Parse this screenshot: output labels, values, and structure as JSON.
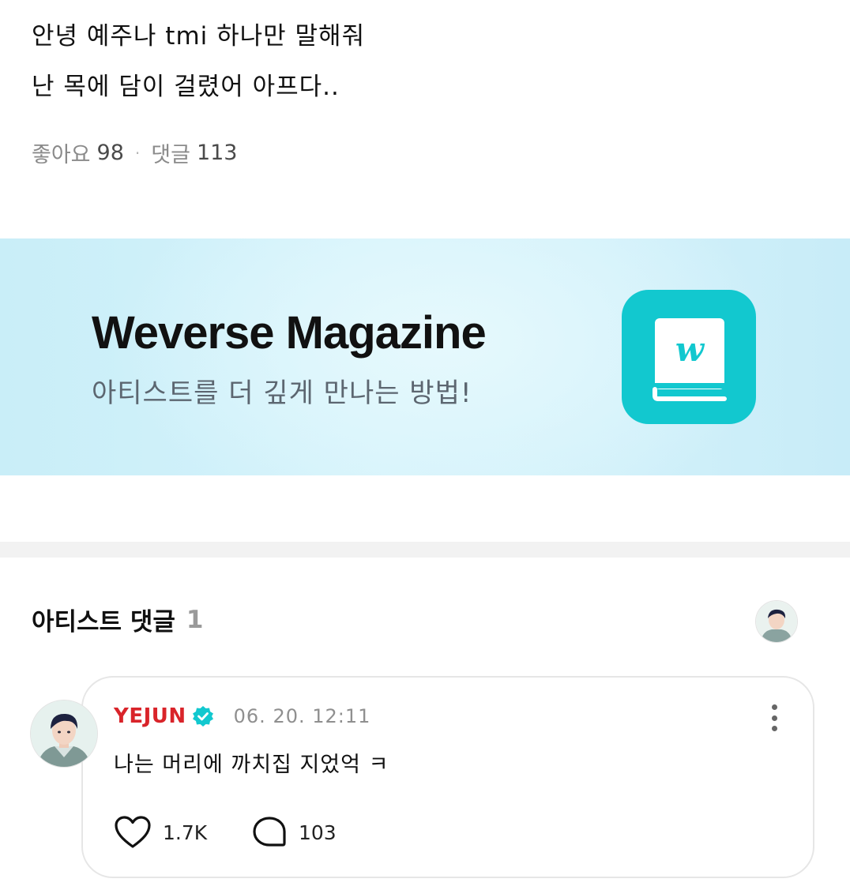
{
  "post": {
    "lines": [
      "안녕 예주나 tmi 하나만 말해줘",
      "난 목에 담이 걸렸어 아프다.."
    ],
    "likes_label": "좋아요",
    "likes_count": "98",
    "separator": "·",
    "comments_label": "댓글",
    "comments_count": "113"
  },
  "banner": {
    "title": "Weverse Magazine",
    "subtitle": "아티스트를 더 깊게 만나는 방법!",
    "icon": "weverse-magazine-book-icon",
    "icon_letter": "w",
    "accent_color": "#12c8cf"
  },
  "artist_comments": {
    "title": "아티스트 댓글",
    "count": "1",
    "comment": {
      "author": "YEJUN",
      "author_color": "#d9242a",
      "verified_icon": "verified-badge-icon",
      "date": "06. 20. 12:11",
      "text": "나는 머리에 까치집 지었억 ㅋ",
      "likes": "1.7K",
      "replies": "103"
    }
  }
}
